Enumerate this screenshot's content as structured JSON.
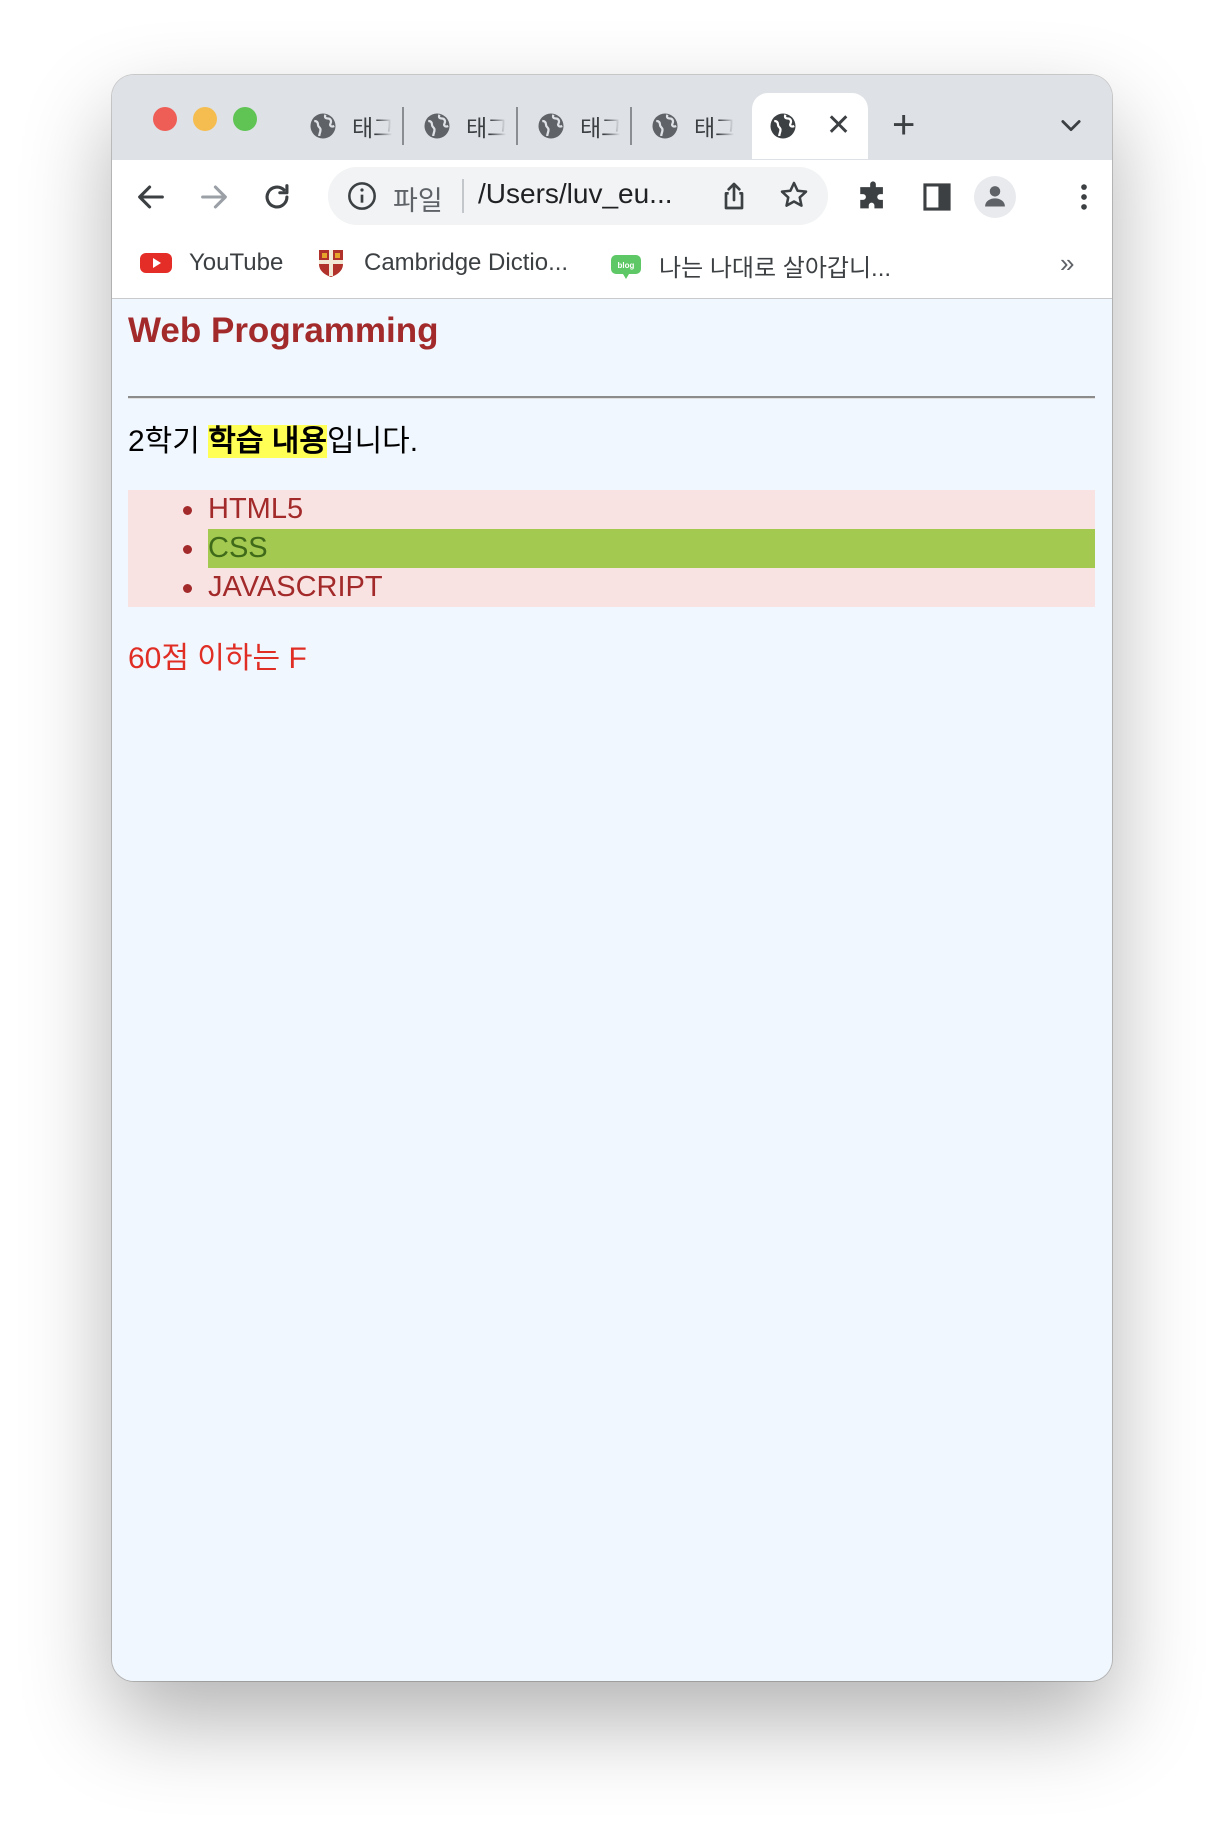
{
  "tabs": [
    {
      "title": "태그"
    },
    {
      "title": "태그"
    },
    {
      "title": "태그"
    },
    {
      "title": "태그"
    },
    {
      "title": "",
      "active": true
    }
  ],
  "toolbar": {
    "file_label": "파일",
    "url": "/Users/luv_eu..."
  },
  "bookmarks": [
    {
      "label": "YouTube",
      "icon": "youtube-icon"
    },
    {
      "label": "Cambridge Dictio...",
      "icon": "cambridge-crest-icon"
    },
    {
      "label": "나는 나대로 살아갑니...",
      "icon": "blog-icon"
    }
  ],
  "bookmarks_more": "»",
  "page": {
    "title": "Web Programming",
    "intro_prefix": "2학기 ",
    "intro_highlight": "학습 내용",
    "intro_suffix": "입니다.",
    "topics": [
      "HTML5",
      "CSS",
      "JAVASCRIPT"
    ],
    "highlighted_topic_index": 1,
    "note": "60점 이하는 F"
  },
  "colors": {
    "heading": "#a32a2a",
    "list_bg": "#f9e3e2",
    "list_highlight": "#a4c950",
    "mark": "#ffff55",
    "note": "#e02e25",
    "page_bg": "#f0f7fe"
  }
}
